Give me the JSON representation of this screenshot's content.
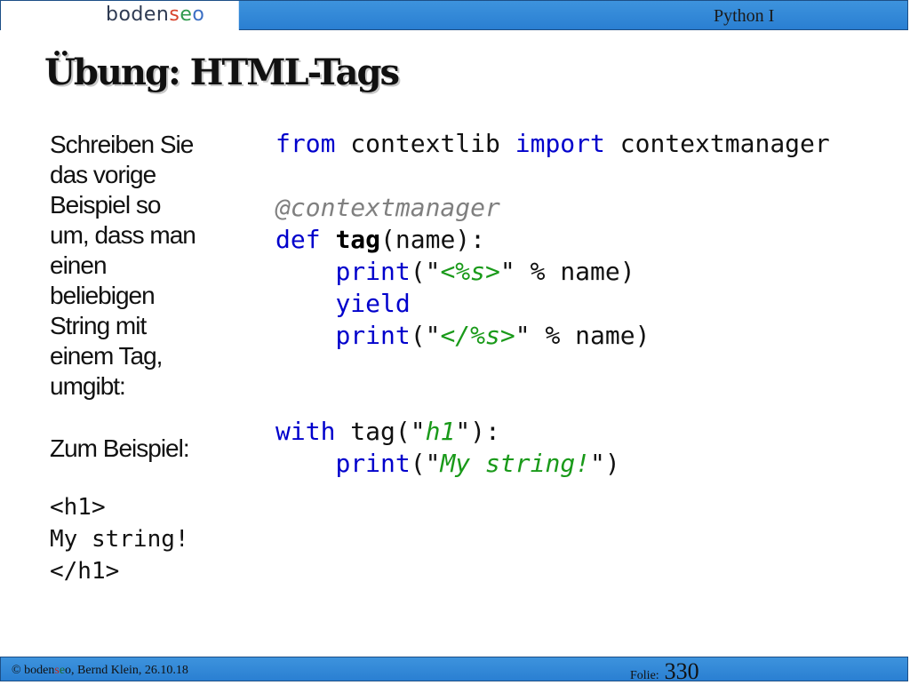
{
  "header": {
    "logo": {
      "part1": "boden",
      "part2": "s",
      "part3": "e",
      "part4": "o"
    },
    "course": "Python I"
  },
  "title": "Übung: HTML-Tags",
  "instructions": [
    "Schreiben Sie",
    "das vorige",
    "Beispiel so",
    "um, dass man",
    "einen",
    "beliebigen",
    "String mit",
    "einem Tag,",
    "umgibt:"
  ],
  "example_label": "Zum Beispiel:",
  "example_output": [
    "<h1>",
    "My string!",
    "</h1>"
  ],
  "code": {
    "l1": {
      "kw_from": "from",
      "mod": " contextlib ",
      "kw_import": "import",
      "name": " contextmanager"
    },
    "l2": {
      "decorator": "@contextmanager"
    },
    "l3": {
      "kw_def": "def",
      "sp": " ",
      "fname": "tag",
      "params": "(name):"
    },
    "l4": {
      "indent": "    ",
      "kw_print": "print",
      "open": "(\"",
      "str": "<%s>",
      "close": "\" % name)"
    },
    "l5": {
      "indent": "    ",
      "kw_yield": "yield"
    },
    "l6": {
      "indent": "    ",
      "kw_print": "print",
      "open": "(\"",
      "str": "</%s>",
      "close": "\" % name)"
    },
    "l7": {
      "kw_with": "with",
      "call": " tag(\"",
      "arg": "h1",
      "close": "\"):"
    },
    "l8": {
      "indent": "    ",
      "kw_print": "print",
      "open": "(\"",
      "str": "My string!",
      "close": "\")"
    }
  },
  "footer": {
    "copyright": "© ",
    "brand": {
      "part1": "boden",
      "part2": "s",
      "part3": "e",
      "part4": "o"
    },
    "author": ", Bernd Klein, 26.10.18",
    "folie_label": "Folie:",
    "folie_number": "330"
  }
}
